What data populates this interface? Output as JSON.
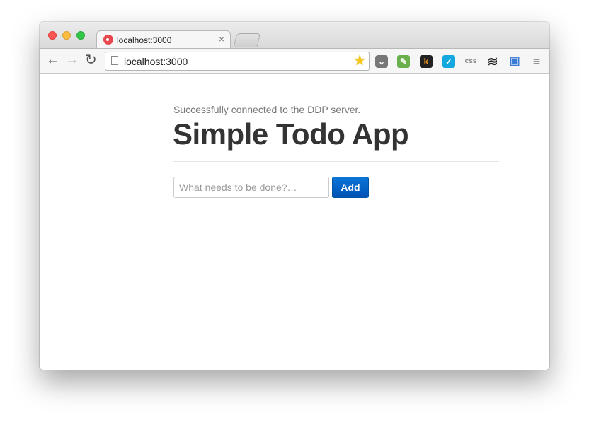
{
  "browser": {
    "tab": {
      "title": "localhost:3000",
      "close_label": "×"
    },
    "address_bar": {
      "url": "localhost:3000"
    },
    "nav": {
      "back_icon": "arrow-left-icon",
      "forward_icon": "arrow-right-icon",
      "reload_icon": "reload-icon"
    },
    "extensions": {
      "pocket": "pocket-icon",
      "evernote": "evernote-icon",
      "k_label": "k",
      "check_label": "✓",
      "css_label": "css",
      "layers": "layers-icon",
      "screen": "screenshot-icon",
      "menu": "hamburger-menu-icon"
    }
  },
  "page": {
    "status": "Successfully connected to the DDP server.",
    "title": "Simple Todo App",
    "input": {
      "placeholder": "What needs to be done?…",
      "value": ""
    },
    "add_button": "Add"
  },
  "colors": {
    "accent": "#0b6fd1",
    "title_text": "#333333",
    "status_text": "#777777",
    "traffic_red": "#fc5753",
    "traffic_yellow": "#fdbc40",
    "traffic_green": "#33c748"
  }
}
